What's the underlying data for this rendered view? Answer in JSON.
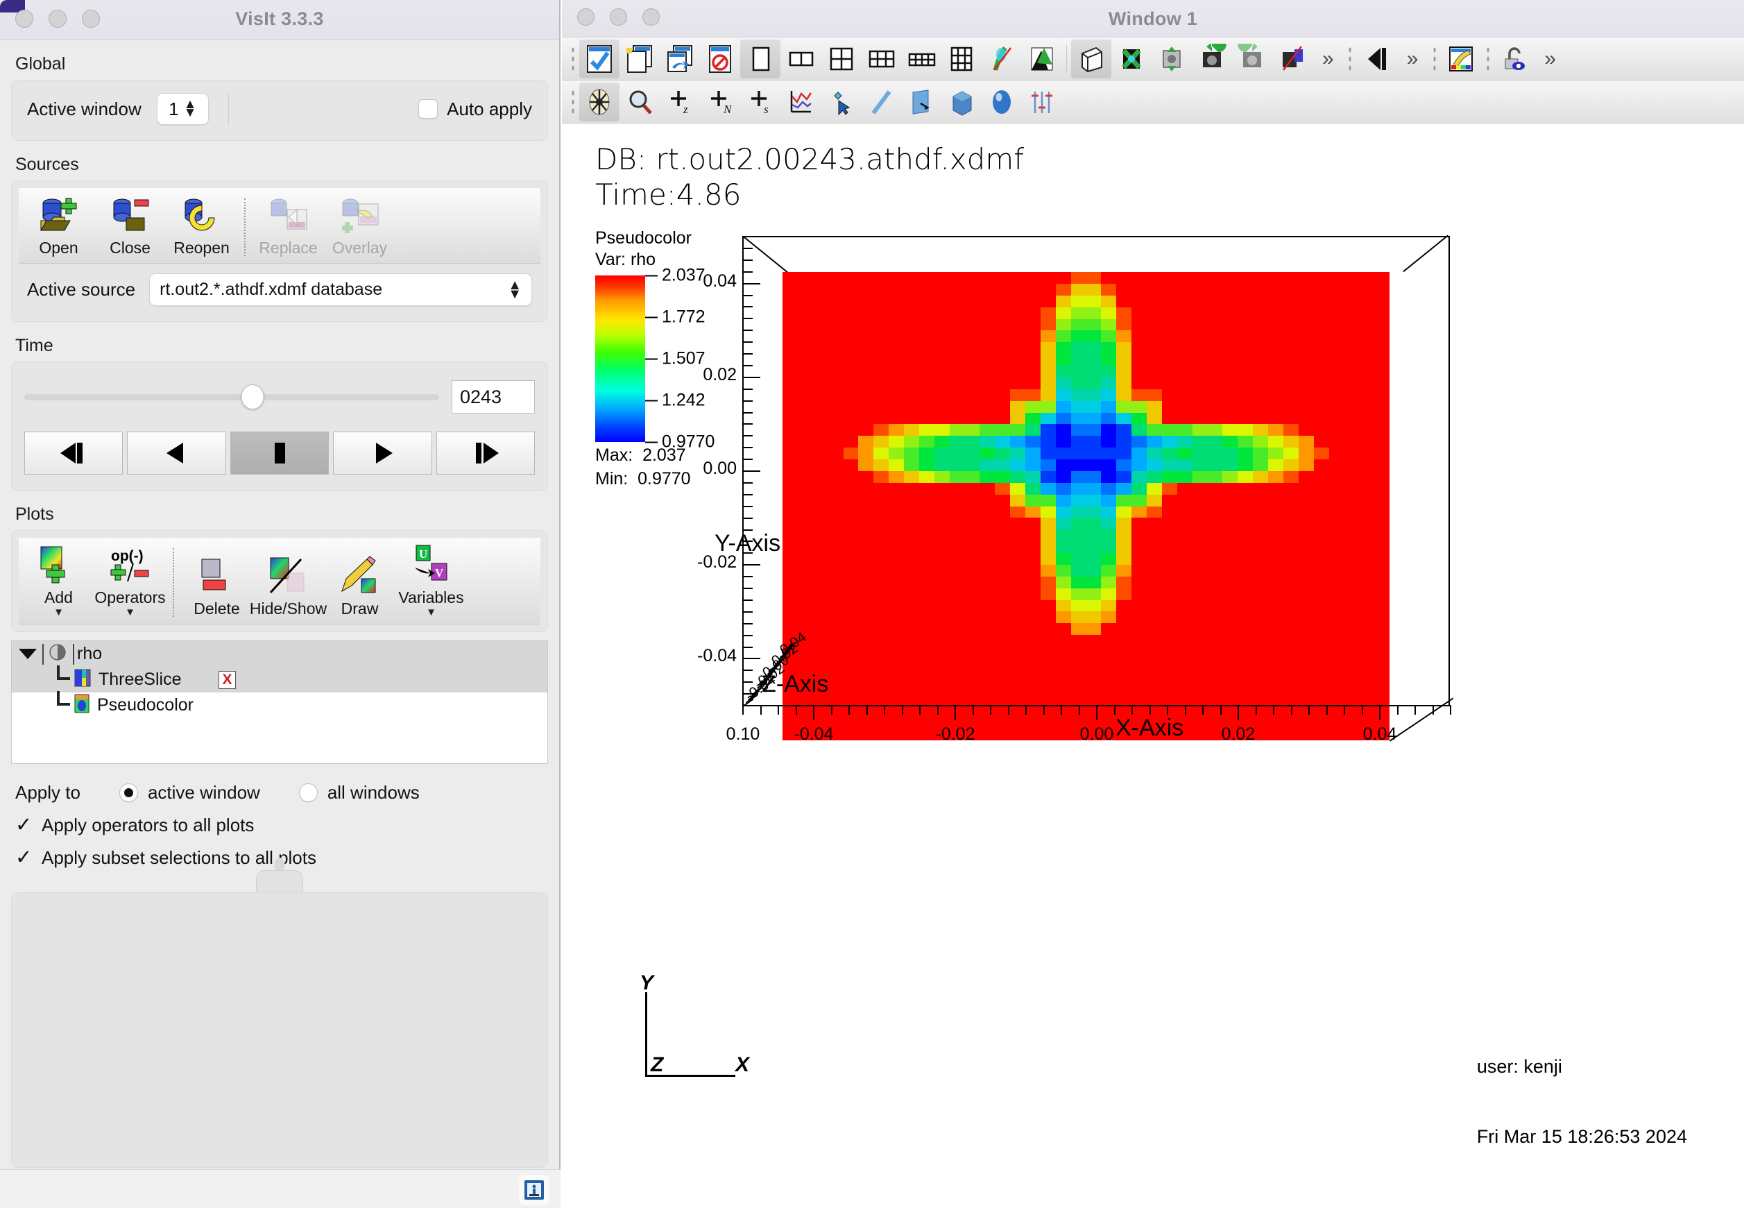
{
  "control_window": {
    "title": "VisIt 3.3.3",
    "global": {
      "label": "Global",
      "active_window_label": "Active window",
      "active_window_value": "1",
      "auto_apply_label": "Auto apply",
      "auto_apply_checked": false
    },
    "sources": {
      "label": "Sources",
      "buttons": [
        {
          "label": "Open",
          "icon": "open-database-icon",
          "enabled": true
        },
        {
          "label": "Close",
          "icon": "close-database-icon",
          "enabled": true
        },
        {
          "label": "Reopen",
          "icon": "reopen-database-icon",
          "enabled": true
        },
        {
          "label": "Replace",
          "icon": "replace-database-icon",
          "enabled": false
        },
        {
          "label": "Overlay",
          "icon": "overlay-database-icon",
          "enabled": false
        }
      ],
      "active_source_label": "Active source",
      "active_source_value": "rt.out2.*.athdf.xdmf database"
    },
    "time": {
      "label": "Time",
      "cycle_value": "0243",
      "slider_percent": 55,
      "transport": [
        {
          "name": "step-backward-button",
          "icon": "prev-frame-icon"
        },
        {
          "name": "play-reverse-button",
          "icon": "play-reverse-icon"
        },
        {
          "name": "stop-button",
          "icon": "stop-icon",
          "active": true
        },
        {
          "name": "play-button",
          "icon": "play-icon"
        },
        {
          "name": "step-forward-button",
          "icon": "next-frame-icon"
        }
      ]
    },
    "plots": {
      "label": "Plots",
      "buttons": [
        {
          "label": "Add",
          "icon": "add-plot-icon",
          "menu": true
        },
        {
          "label": "Operators",
          "icon": "operators-icon",
          "menu": true
        },
        {
          "label": "Delete",
          "icon": "delete-plot-icon",
          "menu": false
        },
        {
          "label": "Hide/Show",
          "icon": "hide-show-icon",
          "menu": false
        },
        {
          "label": "Draw",
          "icon": "draw-icon",
          "menu": false
        },
        {
          "label": "Variables",
          "icon": "variables-icon",
          "menu": true
        }
      ],
      "tree": [
        {
          "name": "rho",
          "kind": "group",
          "icon": "plot-group-icon"
        },
        {
          "name": "ThreeSlice",
          "kind": "operator",
          "icon": "threeslice-icon",
          "selected": true,
          "has_delete": true,
          "delete_glyph": "X"
        },
        {
          "name": "Pseudocolor",
          "kind": "plot",
          "icon": "pseudocolor-icon",
          "selected": false
        }
      ]
    },
    "apply": {
      "label": "Apply to",
      "options": [
        {
          "label": "active window",
          "selected": true
        },
        {
          "label": "all windows",
          "selected": false
        }
      ],
      "checkboxes": [
        {
          "label": "Apply operators to all plots",
          "checked": true,
          "mark": "✓"
        },
        {
          "label": "Apply subset selections to all plots",
          "checked": true,
          "mark": "✓"
        }
      ]
    },
    "statusbar": {
      "info_icon": "info-icon"
    }
  },
  "vis_window": {
    "title": "Window 1",
    "toolbar_main": [
      {
        "name": "new-window-check-icon",
        "active": true
      },
      {
        "name": "clone-window-icon"
      },
      {
        "name": "copy-window-icon"
      },
      {
        "name": "delete-window-icon"
      },
      {
        "name": "layout-1x1-icon",
        "active": true
      },
      {
        "name": "layout-1x2-icon"
      },
      {
        "name": "layout-2x2-icon"
      },
      {
        "name": "layout-2x3-icon"
      },
      {
        "name": "layout-2x4-icon"
      },
      {
        "name": "layout-3x3-icon"
      },
      {
        "name": "unlock-view-icon"
      },
      {
        "name": "toggle-perspective-icon"
      },
      {
        "name": "mode-3d-icon",
        "active": true
      },
      {
        "name": "reset-view-icon"
      },
      {
        "name": "recenter-view-icon"
      },
      {
        "name": "undo-view-icon"
      },
      {
        "name": "redo-view-icon"
      },
      {
        "name": "clear-view-icon"
      },
      {
        "name": "overflow-chevron-1"
      },
      {
        "name": "nav-back-icon"
      },
      {
        "name": "overflow-chevron-2"
      },
      {
        "name": "color-table-icon"
      },
      {
        "name": "lock-view-icon"
      },
      {
        "name": "overflow-chevron-3"
      }
    ],
    "toolbar_tools": [
      {
        "name": "navigate-icon",
        "active": true
      },
      {
        "name": "zoom-tool-icon"
      },
      {
        "name": "pick-zone-icon"
      },
      {
        "name": "pick-node-icon"
      },
      {
        "name": "pick-spreadsheet-icon"
      },
      {
        "name": "lineout-icon"
      },
      {
        "name": "point-tool-icon"
      },
      {
        "name": "line-tool-icon"
      },
      {
        "name": "plane-tool-icon"
      },
      {
        "name": "box-tool-icon"
      },
      {
        "name": "sphere-tool-icon"
      },
      {
        "name": "axis-restriction-icon"
      }
    ],
    "canvas": {
      "db_line1": "DB: rt.out2.00243.athdf.xdmf",
      "db_line2": "Time:4.86",
      "legend": {
        "plot_type": "Pseudocolor",
        "variable": "Var: rho",
        "max_label": "Max:  2.037",
        "min_label": "Min:  0.9770"
      },
      "triad": {
        "x": "X",
        "y": "Y",
        "z": "Z"
      },
      "user_line1": "user: kenji",
      "user_line2": "Fri Mar 15 18:26:53 2024"
    }
  },
  "chart_data": {
    "type": "heatmap",
    "title": "DB: rt.out2.00243.athdf.xdmf",
    "subtitle": "Time:4.86",
    "variable": "rho",
    "plot_type": "Pseudocolor",
    "colormap": "hot_desaturated_rainbow",
    "vmin": 0.977,
    "vmax": 2.037,
    "legend_ticks": [
      2.037,
      1.772,
      1.507,
      1.242,
      0.977
    ],
    "legend_tick_labels": [
      "2.037",
      "1.772",
      "1.507",
      "1.242",
      "0.9770"
    ],
    "max": 2.037,
    "min": 0.977,
    "xlabel": "X-Axis",
    "ylabel": "Y-Axis",
    "zlabel": "Z-Axis",
    "x_ticks": [
      -0.04,
      -0.02,
      0.0,
      0.02,
      0.04
    ],
    "x_tick_labels": [
      "-0.04",
      "-0.02",
      "0.00",
      "0.02",
      "0.04"
    ],
    "x_extra_tick_label": "0.10",
    "y_ticks": [
      -0.04,
      -0.02,
      0.0,
      0.02,
      0.04
    ],
    "y_tick_labels": [
      "-0.04",
      "-0.02",
      "0.00",
      "0.02",
      "0.04"
    ],
    "z_tick_labels": [
      "-0.04",
      "-0.02",
      "0.00",
      "0.02",
      "0.04"
    ],
    "xlim": [
      -0.05,
      0.05
    ],
    "ylim": [
      -0.05,
      0.05
    ],
    "zlim": [
      -0.05,
      0.05
    ],
    "grid": false,
    "legend_position": "left",
    "description": "Three-slice pseudocolor of density rho showing a symmetric Rayleigh-Taylor plume structure; background value saturates at the maximum (red) with a low-density (blue) snowflake-shaped core."
  }
}
